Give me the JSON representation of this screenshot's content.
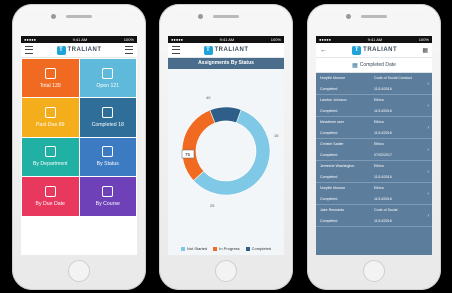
{
  "status": {
    "carrier": "●●●●●",
    "time": "9:41 AM",
    "battery": "100%"
  },
  "brand": {
    "name": "TRALIANT"
  },
  "phone1": {
    "tiles": [
      {
        "label": "Total 139",
        "color": "#f06a22",
        "icon": "clipboard-icon"
      },
      {
        "label": "Open 121",
        "color": "#5eb9da",
        "icon": "folder-icon"
      },
      {
        "label": "Past Due 89",
        "color": "#f4ad1b",
        "icon": "calendar-icon"
      },
      {
        "label": "Completed 18",
        "color": "#2f6e99",
        "icon": "checklist-icon"
      },
      {
        "label": "By Department",
        "color": "#21b1a4",
        "icon": "monitor-icon"
      },
      {
        "label": "By Status",
        "color": "#3c7bc2",
        "icon": "clock-icon"
      },
      {
        "label": "By Due Date",
        "color": "#e8385e",
        "icon": "calendar-icon"
      },
      {
        "label": "By Course",
        "color": "#6e41b8",
        "icon": "bar-chart-icon"
      }
    ]
  },
  "phone2": {
    "title": "Assignments By Status",
    "chart_data": {
      "type": "pie",
      "labels": [
        "Not Started",
        "In Progress",
        "Completed"
      ],
      "values": [
        75,
        40,
        15
      ],
      "colors": [
        "#7fc8e6",
        "#f06a22",
        "#2f5f88"
      ],
      "tooltip": "75"
    },
    "legend": [
      "Not Started",
      "In Progress",
      "Completed"
    ],
    "value_labels": {
      "top": "40",
      "right": "15",
      "bottom": "25"
    }
  },
  "phone3": {
    "title": "Completed Date",
    "rows": [
      {
        "name": "Nuryille Monroe",
        "course": "Code of Social Conduct",
        "status": "Completed",
        "date": "11/14/2016"
      },
      {
        "name": "Landon Johnson",
        "course": "Ethics",
        "status": "Completed",
        "date": "11/14/2016"
      },
      {
        "name": "Meademe user",
        "course": "Ethics",
        "status": "Completed",
        "date": "11/14/2016"
      },
      {
        "name": "Christel Sadler",
        "course": "Ethics",
        "status": "Completed",
        "date": "07/02/2017"
      },
      {
        "name": "Jemeshe Washington",
        "course": "Ethics",
        "status": "Completed",
        "date": "11/14/2016"
      },
      {
        "name": "Nuryille Monroe",
        "course": "Ethics",
        "status": "Completed",
        "date": "11/14/2016"
      },
      {
        "name": "Jake Resnardo",
        "course": "Code of Social",
        "status": "Completed",
        "date": "11/14/2016"
      }
    ]
  }
}
